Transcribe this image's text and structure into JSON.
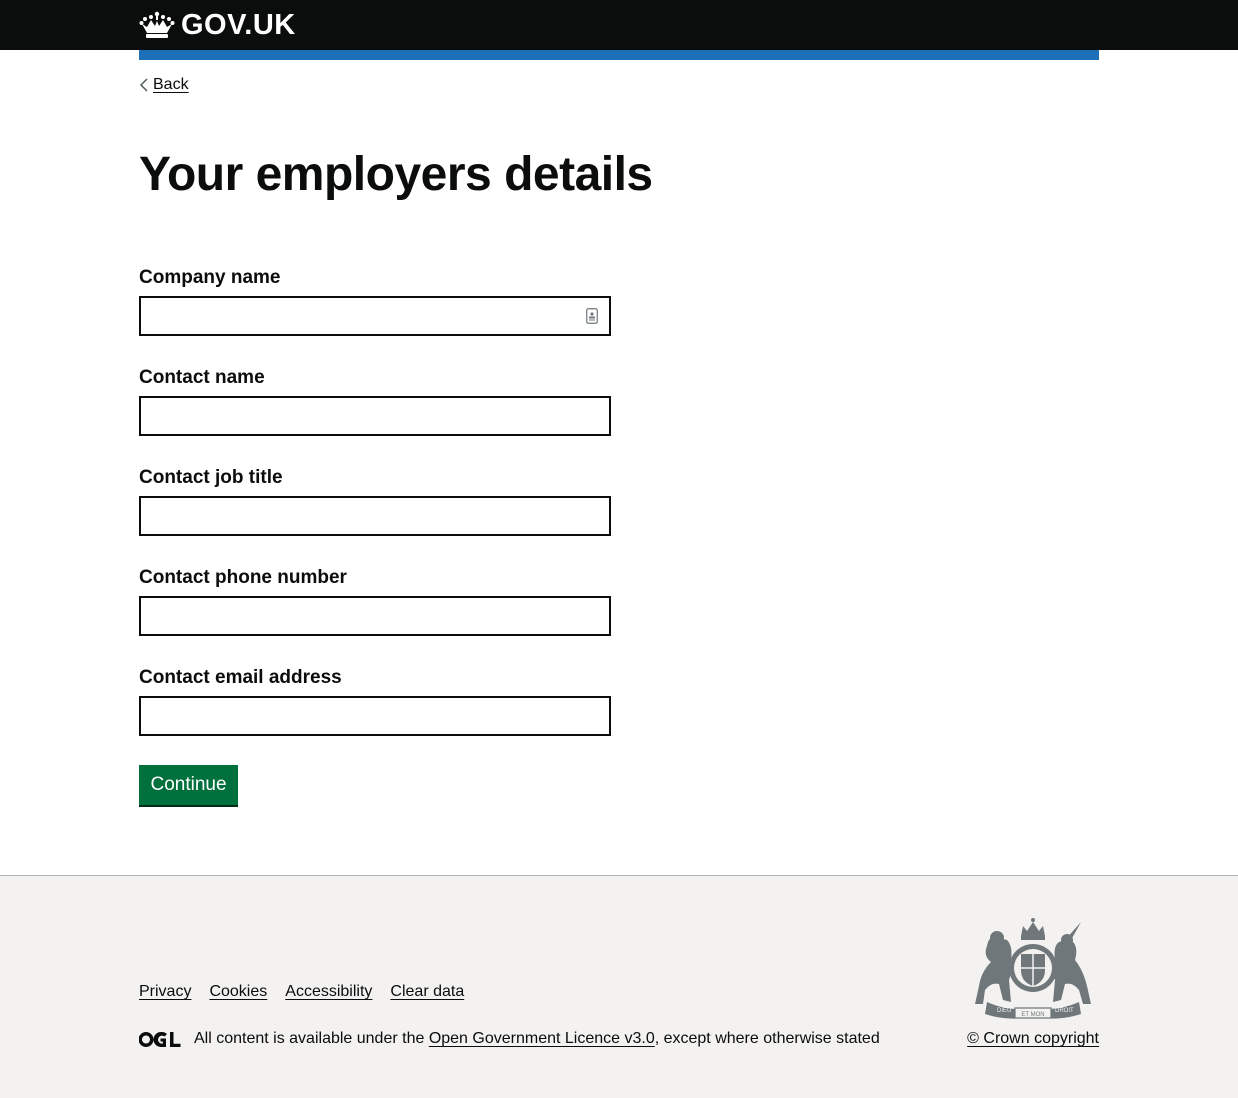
{
  "header": {
    "logo_text": "GOV.UK",
    "logo_icon": "crown-icon",
    "accent_color": "#1d70b8",
    "background_color": "#0b0c0c"
  },
  "nav": {
    "back_label": "Back",
    "back_icon": "chevron-left-icon"
  },
  "main": {
    "title": "Your employers details",
    "fields": [
      {
        "label": "Company name",
        "value": "",
        "autofill_icon": "contact-card-icon"
      },
      {
        "label": "Contact name",
        "value": ""
      },
      {
        "label": "Contact job title",
        "value": ""
      },
      {
        "label": "Contact phone number",
        "value": ""
      },
      {
        "label": "Contact email address",
        "value": ""
      }
    ],
    "continue_label": "Continue",
    "button_color": "#00703c"
  },
  "footer": {
    "links": [
      "Privacy",
      "Cookies",
      "Accessibility",
      "Clear data"
    ],
    "ogl_icon": "ogl-logo",
    "licence_prefix": "All content is available under the ",
    "licence_link": "Open Government Licence v3.0",
    "licence_suffix": ", except where otherwise stated",
    "crest_icon": "royal-coat-of-arms-icon",
    "crest_motto_left": "DIEU",
    "crest_motto_middle": "ET MON",
    "crest_motto_right": "DROIT",
    "copyright": "© Crown copyright",
    "background_color": "#f3f2f1"
  }
}
